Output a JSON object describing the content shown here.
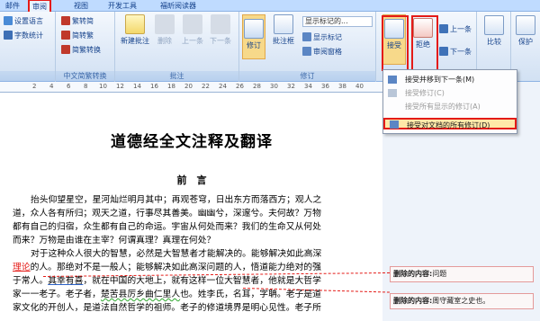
{
  "tabs": [
    {
      "label": "邮件"
    },
    {
      "label": "审阅"
    },
    {
      "label": "视图"
    },
    {
      "label": "开发工具"
    },
    {
      "label": "福昕阅读器"
    }
  ],
  "ribbon": {
    "proof": {
      "set_language": "设置语言",
      "word_count": "字数统计"
    },
    "chinese": {
      "to_simplified": "繁转简",
      "to_traditional": "简转繁",
      "convert": "简繁转换",
      "label": "中文简繁转换"
    },
    "comments": {
      "new": "新建批注",
      "delete": "删除",
      "prev": "上一条",
      "next": "下一条",
      "label": "批注"
    },
    "tracking": {
      "track": "修订",
      "balloons": "批注框",
      "display_combo": "显示标记的...",
      "show_markup": "显示标记",
      "review_pane": "审阅窗格",
      "label": "修订"
    },
    "changes": {
      "accept": "接受",
      "reject": "拒绝",
      "prev": "上一条",
      "next": "下一条"
    },
    "compare": {
      "label": "比较"
    },
    "protect": {
      "label": "保护"
    }
  },
  "menu": {
    "items": [
      {
        "label": "接受并移到下一条(M)",
        "enabled": true
      },
      {
        "label": "接受修订(C)",
        "enabled": false
      },
      {
        "label": "接受所有显示的修订(A)",
        "enabled": false
      },
      {
        "label": "接受对文档的所有修订(D)",
        "enabled": true,
        "selected": true
      }
    ]
  },
  "ruler": {
    "ticks": [
      "2",
      "4",
      "6",
      "8",
      "10",
      "12",
      "14",
      "16",
      "18",
      "20",
      "22",
      "24",
      "26",
      "28",
      "30",
      "32",
      "34",
      "36",
      "38",
      "40"
    ]
  },
  "document": {
    "title": "道德经全文注释及翻译",
    "heading": "前　言",
    "p1": [
      "抬头仰望星空，星河灿烂明月其中；再观苍穹，日出东方而落西方；观人之",
      "道，众人各有所归；观天之道，行事尽其善美。幽幽兮，深邃兮。夫何故？万物",
      "都有自己的归宿，众生都有自己的命运。宇宙从何处而来？我们的生命又从何处",
      "而来？万物是由谁在主宰？何谓真理？真理在何处？"
    ],
    "p2_line1": "对于这种众人很大的智慧，必然是大智慧者才能解决的。能够解决如此高深",
    "p2_line2": {
      "ins": "理论",
      "a": "的人。那绝对不是一般人；能够解决如此高深问题的人，悟道能力绝对的强"
    },
    "p2_line3": {
      "a": "于常人。",
      "b": "其幸有喜",
      "c": "，就在中国的大地上，就有这样一位大智慧者，他就是大哲学"
    },
    "p2_line4": {
      "a": "家一一老子。老子者，",
      "b": "楚苦县厉乡曲仁里人",
      "c": "也。姓李氏，名耳，字聃。老子是道"
    },
    "p2_line5": "家文化的开创人，是道法自然哲学的祖师。老子的修道境界是明心见性。老子所"
  },
  "balloons": [
    {
      "label": "删除的内容:",
      "value": "问题"
    },
    {
      "label": "删除的内容:",
      "value": "周守藏室之史也。"
    }
  ]
}
